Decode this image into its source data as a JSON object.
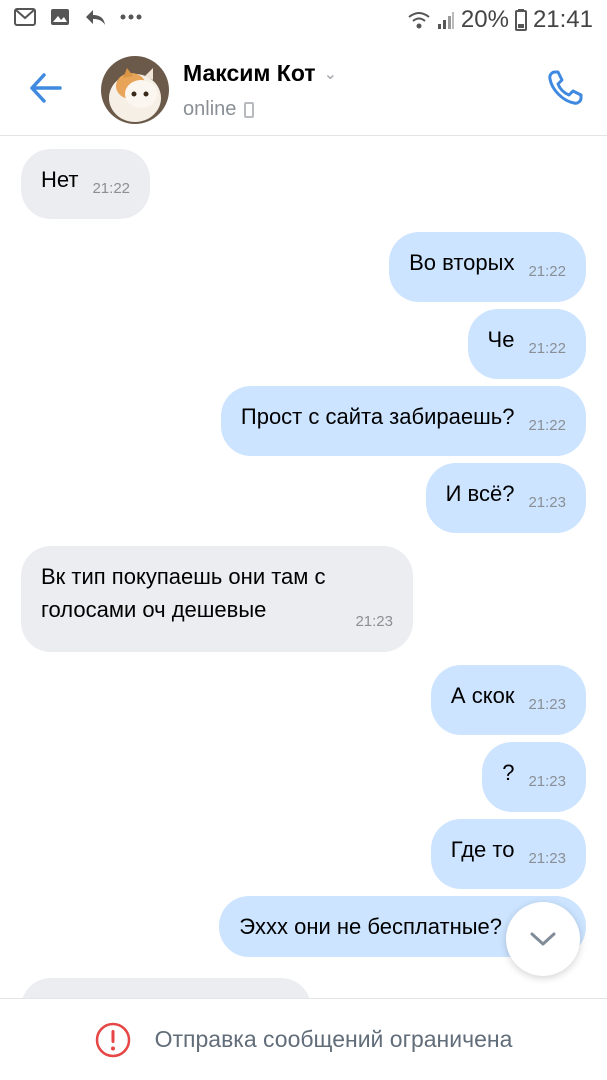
{
  "status_bar": {
    "battery": "20%",
    "time": "21:41",
    "left_icons": [
      "gmail-icon",
      "gallery-icon",
      "reply-icon",
      "more-icon"
    ]
  },
  "header": {
    "title": "Максим Кот",
    "subtitle": "online",
    "accent_color": "#3f8ae0"
  },
  "messages": [
    {
      "dir": "in",
      "text": "Нет",
      "time": "21:22"
    },
    {
      "dir": "out",
      "text": "Во вторых",
      "time": "21:22"
    },
    {
      "dir": "out",
      "text": "Че",
      "time": "21:22"
    },
    {
      "dir": "out",
      "text": "Прост с сайта забираешь?",
      "time": "21:22"
    },
    {
      "dir": "out",
      "text": "И всё?",
      "time": "21:23"
    },
    {
      "dir": "in",
      "text": "Вк тип покупаешь они там с голосами оч дешевые",
      "time": "21:23"
    },
    {
      "dir": "out",
      "text": "А скок",
      "time": "21:23"
    },
    {
      "dir": "out",
      "text": "?",
      "time": "21:23"
    },
    {
      "dir": "out",
      "text": "Где то",
      "time": "21:23"
    },
    {
      "dir": "out",
      "text": "Эххх они не бесплатные?",
      "time": ""
    }
  ],
  "footer": {
    "notice": "Отправка сообщений ограничена",
    "notice_color": "#e64646"
  }
}
